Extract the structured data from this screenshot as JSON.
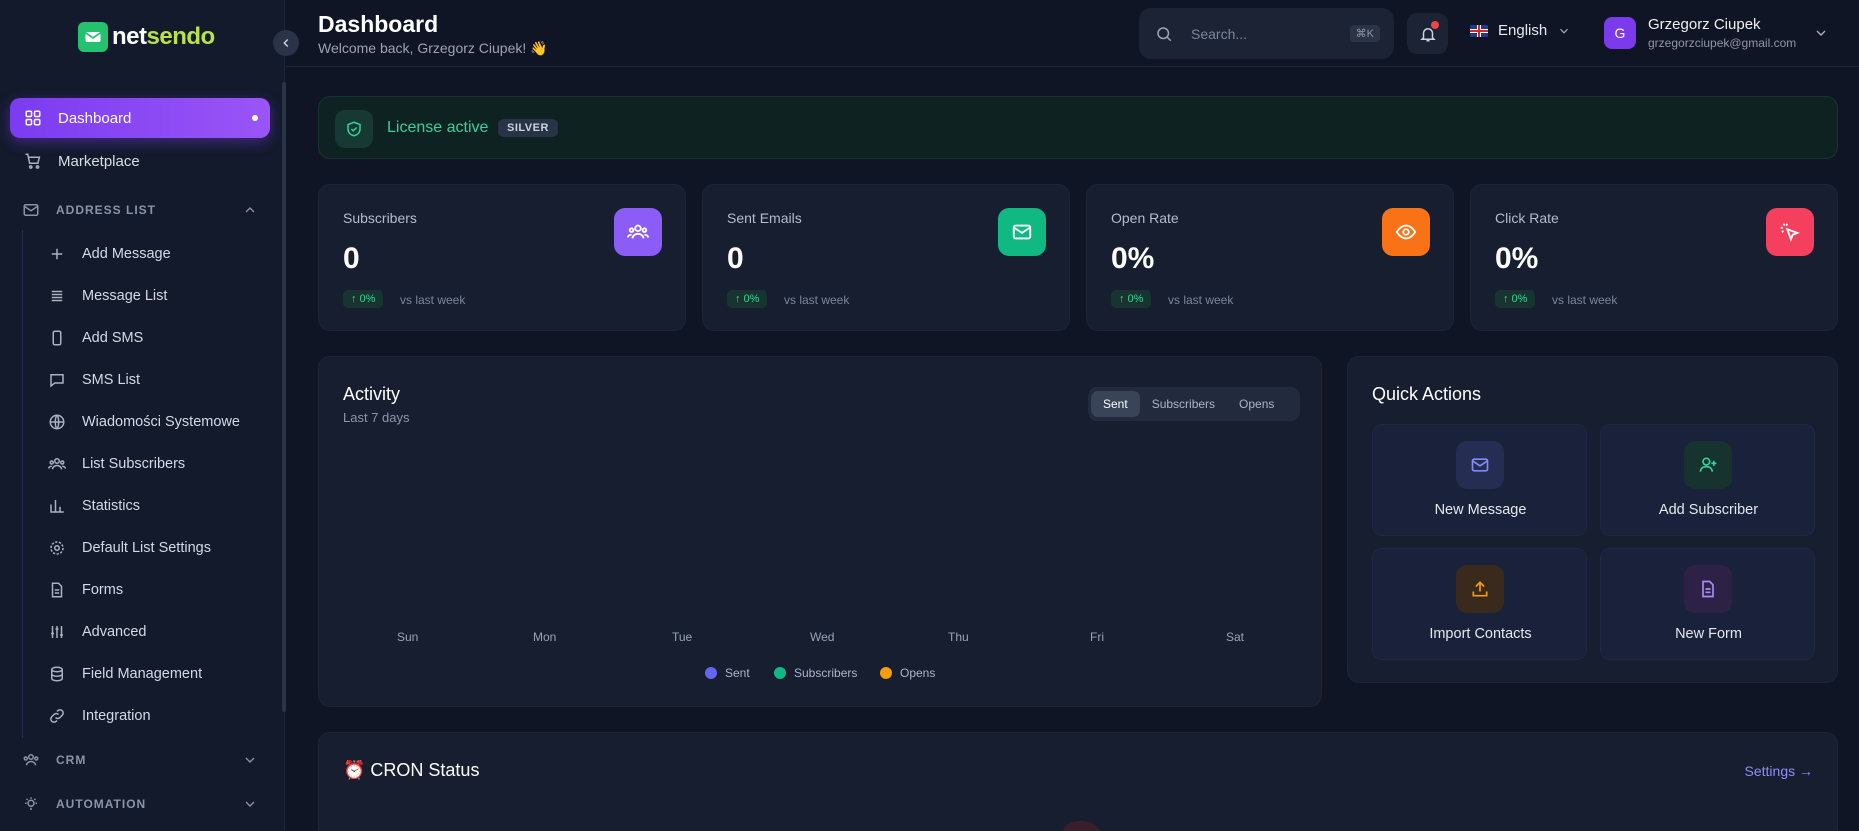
{
  "brand": {
    "part1": "net",
    "part2": "sendo"
  },
  "header": {
    "title": "Dashboard",
    "subtitle": "Welcome back, Grzegorz Ciupek! 👋",
    "search_placeholder": "Search...",
    "search_shortcut": "⌘K",
    "language": "English",
    "user_initial": "G",
    "user_name": "Grzegorz Ciupek",
    "user_email": "grzegorzciupek@gmail.com"
  },
  "sidebar": {
    "dashboard": "Dashboard",
    "marketplace": "Marketplace",
    "address_list": "ADDRESS LIST",
    "sub_items": [
      "Add Message",
      "Message List",
      "Add SMS",
      "SMS List",
      "Wiadomości Systemowe",
      "List Subscribers",
      "Statistics",
      "Default List Settings",
      "Forms",
      "Advanced",
      "Field Management",
      "Integration"
    ],
    "crm": "CRM",
    "automation": "AUTOMATION"
  },
  "license": {
    "text": "License active",
    "tier": "SILVER"
  },
  "stats": [
    {
      "label": "Subscribers",
      "value": "0",
      "change": "↑ 0%",
      "vs": "vs last week",
      "color": "#8b5cf6"
    },
    {
      "label": "Sent Emails",
      "value": "0",
      "change": "↑ 0%",
      "vs": "vs last week",
      "color": "#10b981"
    },
    {
      "label": "Open Rate",
      "value": "0%",
      "change": "↑ 0%",
      "vs": "vs last week",
      "color": "#f97316"
    },
    {
      "label": "Click Rate",
      "value": "0%",
      "change": "↑ 0%",
      "vs": "vs last week",
      "color": "#f43f5e"
    }
  ],
  "activity": {
    "title": "Activity",
    "subtitle": "Last 7 days",
    "tabs": [
      "Sent",
      "Subscribers",
      "Opens"
    ],
    "days": [
      "Sun",
      "Mon",
      "Tue",
      "Wed",
      "Thu",
      "Fri",
      "Sat"
    ],
    "legend": [
      {
        "name": "Sent",
        "color": "#6366f1"
      },
      {
        "name": "Subscribers",
        "color": "#10b981"
      },
      {
        "name": "Opens",
        "color": "#f59e0b"
      }
    ]
  },
  "quick_actions": {
    "title": "Quick Actions",
    "items": [
      "New Message",
      "Add Subscriber",
      "Import Contacts",
      "New Form"
    ]
  },
  "cron": {
    "title": "⏰ CRON Status",
    "settings_link": "Settings →"
  }
}
